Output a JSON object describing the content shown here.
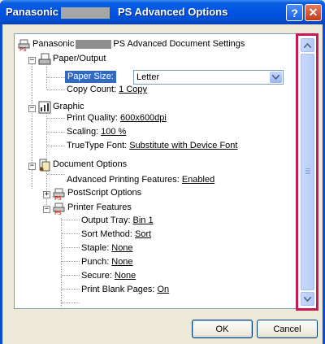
{
  "window": {
    "title_left": "Panasonic",
    "title_right": "PS Advanced Options",
    "help_label": "?",
    "close_label": "✕"
  },
  "tree": {
    "root_label": "Panasonic",
    "root_suffix": "PS Advanced Document Settings",
    "paper_output": "Paper/Output",
    "paper_size_label": "Paper Size:",
    "paper_size_value": "Letter",
    "copy_count_label": "Copy Count:",
    "copy_count_value": "1 Copy",
    "graphic": "Graphic",
    "print_quality_label": "Print Quality:",
    "print_quality_value": "600x600dpi",
    "scaling_label": "Scaling:",
    "scaling_value": "100 %",
    "truetype_label": "TrueType Font:",
    "truetype_value": "Substitute with Device Font",
    "document_options": "Document Options",
    "adv_printing_label": "Advanced Printing Features:",
    "adv_printing_value": "Enabled",
    "postscript_options": "PostScript Options",
    "printer_features": "Printer Features",
    "output_tray_label": "Output Tray:",
    "output_tray_value": "Bin 1",
    "sort_method_label": "Sort Method:",
    "sort_method_value": "Sort",
    "staple_label": "Staple:",
    "staple_value": "None",
    "punch_label": "Punch:",
    "punch_value": "None",
    "secure_label": "Secure:",
    "secure_value": "None",
    "blank_pages_label": "Print Blank Pages:",
    "blank_pages_value": "On"
  },
  "buttons": {
    "ok": "OK",
    "cancel": "Cancel"
  }
}
